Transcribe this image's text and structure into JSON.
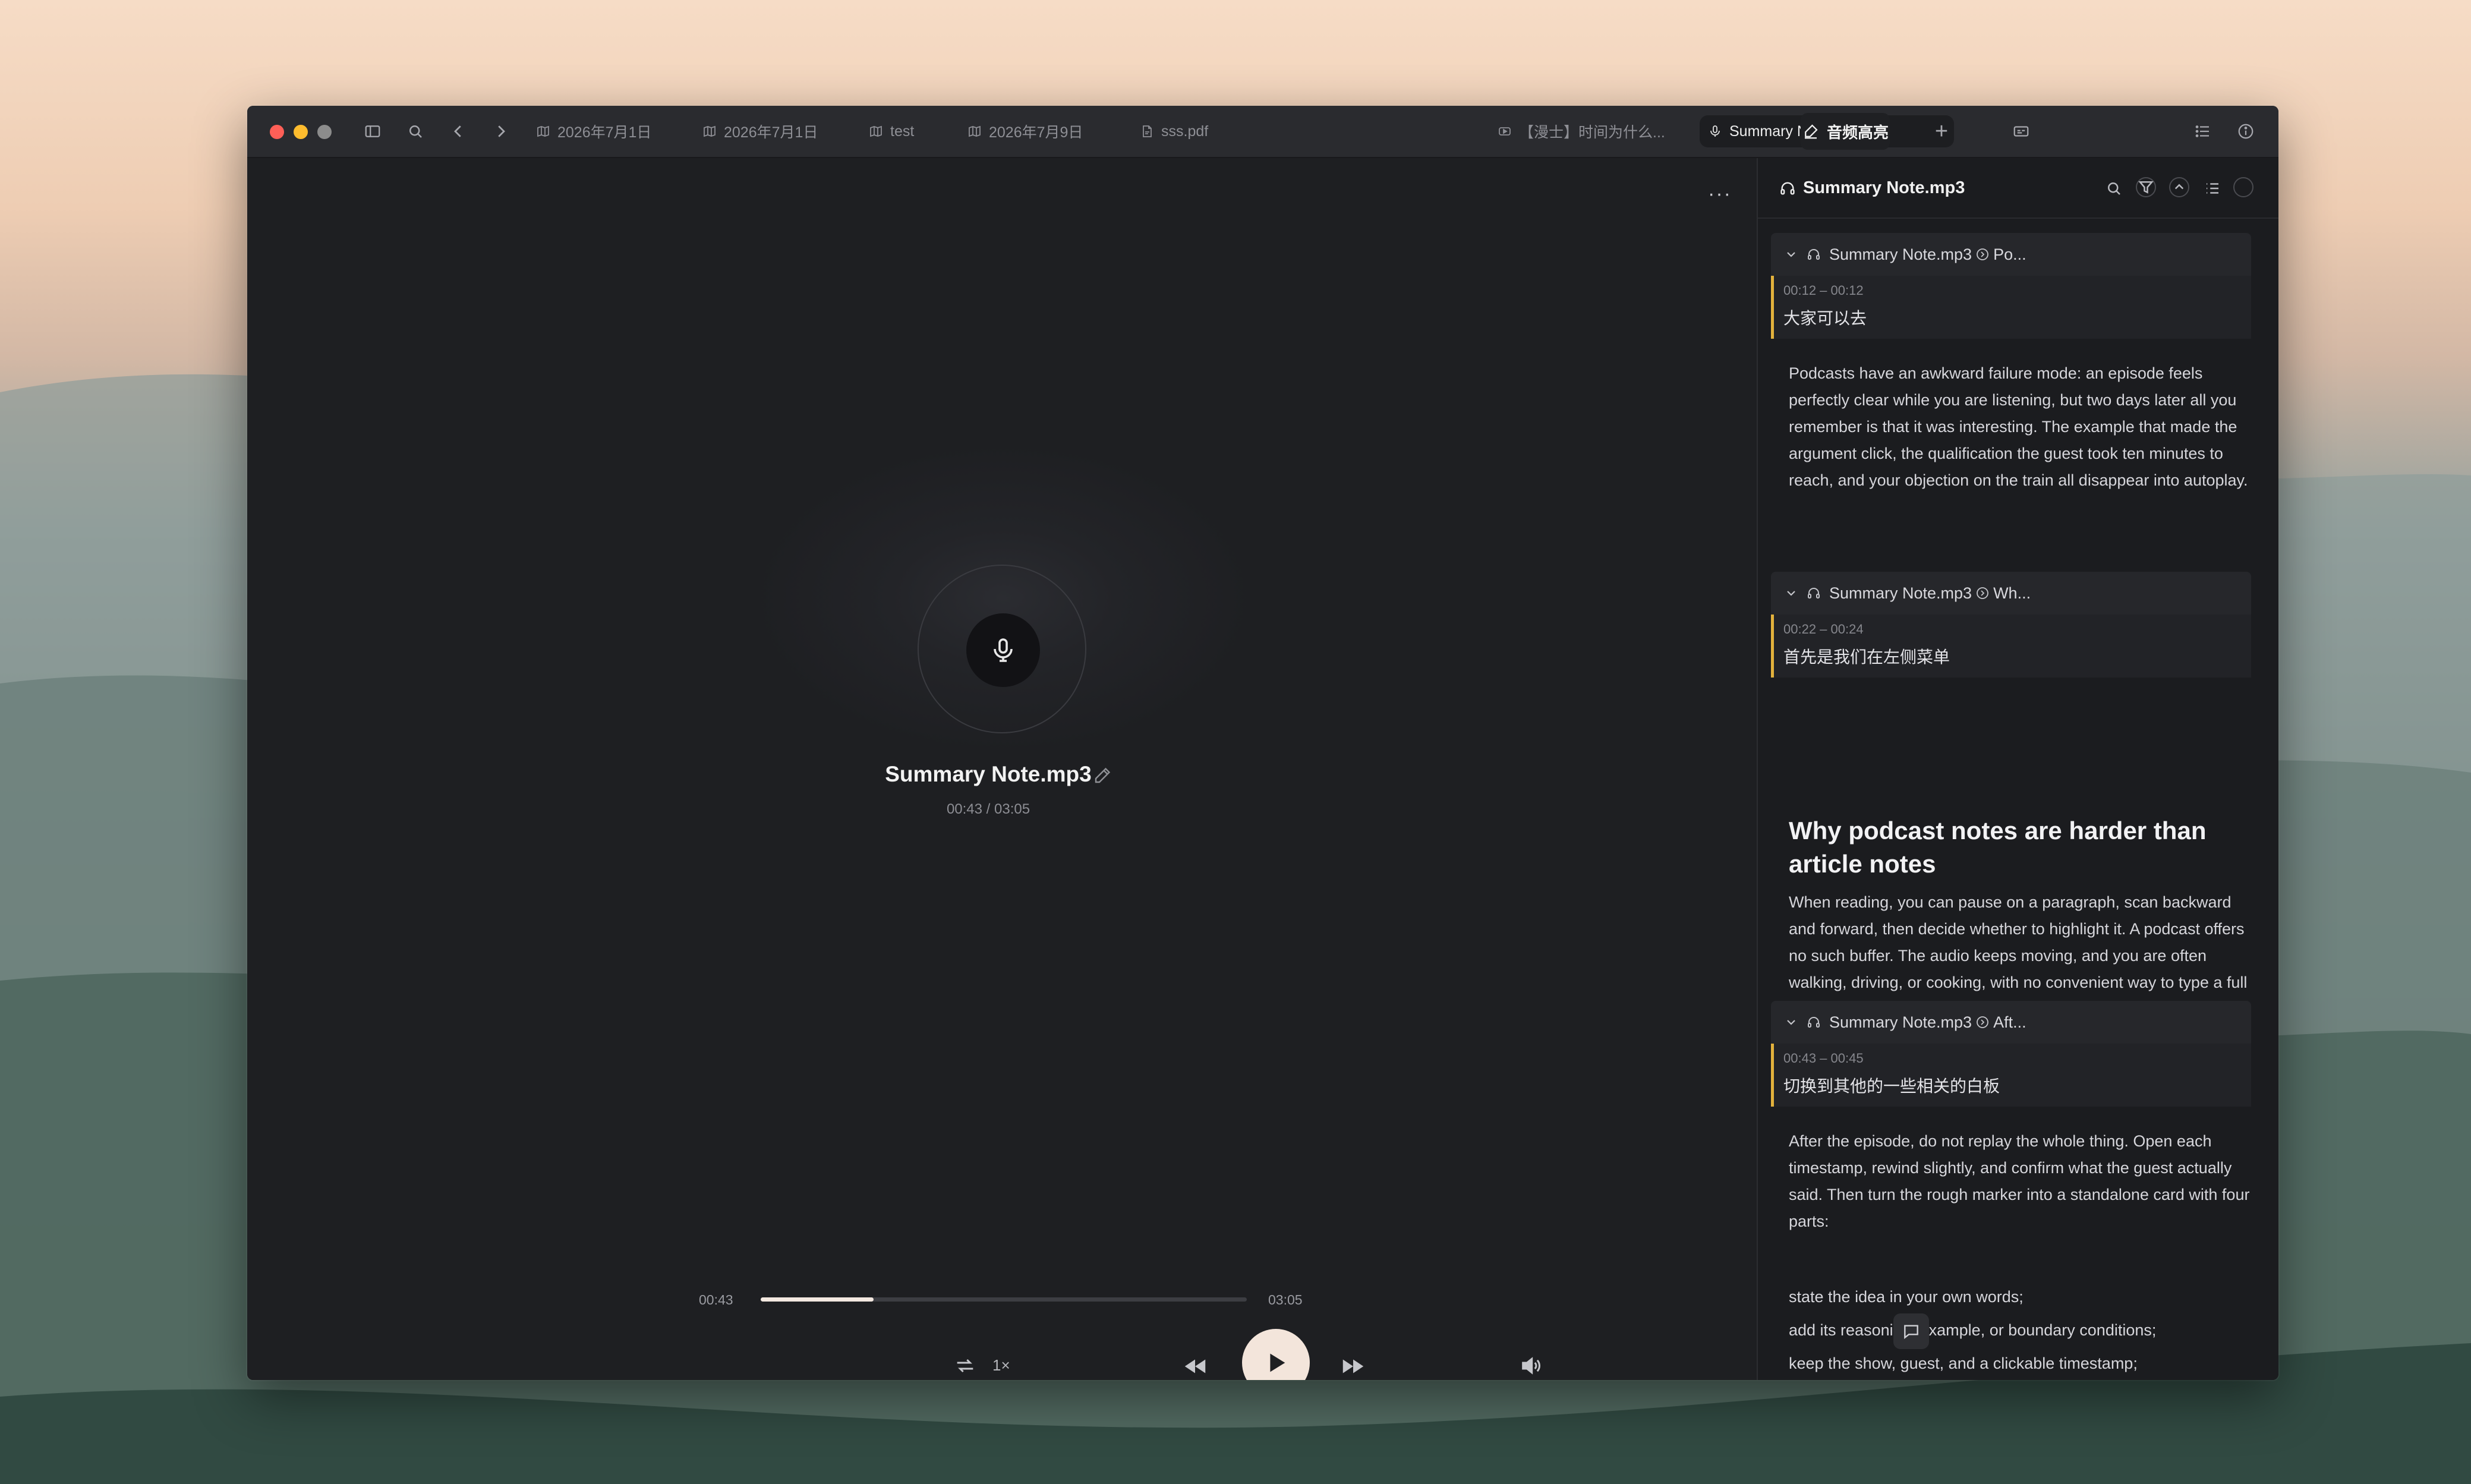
{
  "window": {
    "tabs": [
      {
        "icon": "map-icon",
        "label": "2026年7月1日"
      },
      {
        "icon": "map-icon",
        "label": "2026年7月1日"
      },
      {
        "icon": "map-icon",
        "label": "test"
      },
      {
        "icon": "map-icon",
        "label": "2026年7月9日"
      },
      {
        "icon": "pdf-icon",
        "label": "sss.pdf"
      },
      {
        "icon": "video-icon",
        "label": "【漫士】时间为什么..."
      },
      {
        "icon": "mic-icon",
        "label": "Summary Note.mp3",
        "close": "×"
      }
    ],
    "new_tab": "+",
    "right_tab_label": "音频高亮"
  },
  "player": {
    "more": "···",
    "title": "Summary Note.mp3",
    "time_display": "00:43 / 03:05",
    "current_time": "00:43",
    "duration": "03:05",
    "progress": 0.232,
    "speed": "1×"
  },
  "sidebar": {
    "title": "Summary Note.mp3",
    "cards": [
      {
        "source": "Summary Note.mp3",
        "section": "Po...",
        "time": "00:12 – 00:12",
        "quote": "大家可以去",
        "note": "Podcasts have an awkward failure mode: an episode feels perfectly clear while you are listening, but two days later all you remember is that it was interesting. The example that made the argument click, the qualification the guest took ten minutes to reach, and your objection on the train all disappear into autoplay."
      },
      {
        "source": "Summary Note.mp3",
        "section": "Wh...",
        "time": "00:22 – 00:24",
        "quote": "首先是我们在左侧菜单",
        "heading": "Why podcast notes are harder than article notes",
        "note": "When reading, you can pause on a paragraph, scan backward and forward, then decide whether to highlight it. A podcast offers no such buffer. The audio keeps moving, and you are often walking, driving, or cooking, with no convenient way to type a full sentence."
      },
      {
        "source": "Summary Note.mp3",
        "section": "Aft...",
        "time": "00:43 – 00:45",
        "quote": "切换到其他的一些相关的白板",
        "note": "After the episode, do not replay the whole thing. Open each timestamp, rewind slightly, and confirm what the guest actually said. Then turn the rough marker into a standalone card with four parts:",
        "list": [
          "state the idea in your own words;",
          "add its reasoning, example, or boundary conditions;",
          "keep the show, guest, and a clickable timestamp;"
        ]
      }
    ]
  },
  "colors": {
    "accent_highlight": "#e3b23c",
    "play_button": "#f3e5db",
    "traffic_close": "#ff5f57",
    "traffic_minimize": "#febc2e",
    "traffic_inactive": "#8c8c8c"
  }
}
